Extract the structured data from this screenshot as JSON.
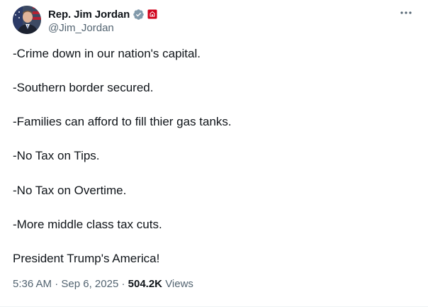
{
  "author": {
    "display_name": "Rep. Jim Jordan",
    "handle": "@Jim_Jordan",
    "avatar_icon": "profile-photo",
    "verified_icon": "verified-gray-badge",
    "affiliation_icon": "us-house-badge"
  },
  "tweet": {
    "lines": [
      "-Crime down in our nation's capital.",
      "-Southern border secured.",
      "-Families can afford to fill thier gas tanks.",
      "-No Tax on Tips.",
      "-No Tax on Overtime.",
      "-More middle class tax cuts.",
      "President Trump's America!"
    ]
  },
  "meta": {
    "time": "5:36 AM",
    "separator": "·",
    "date": "Sep 6, 2025",
    "views_count": "504.2K",
    "views_label": "Views"
  },
  "colors": {
    "text_primary": "#0f1419",
    "text_secondary": "#536471",
    "verified_badge": "#829aab",
    "gov_badge": "#d0021b"
  }
}
